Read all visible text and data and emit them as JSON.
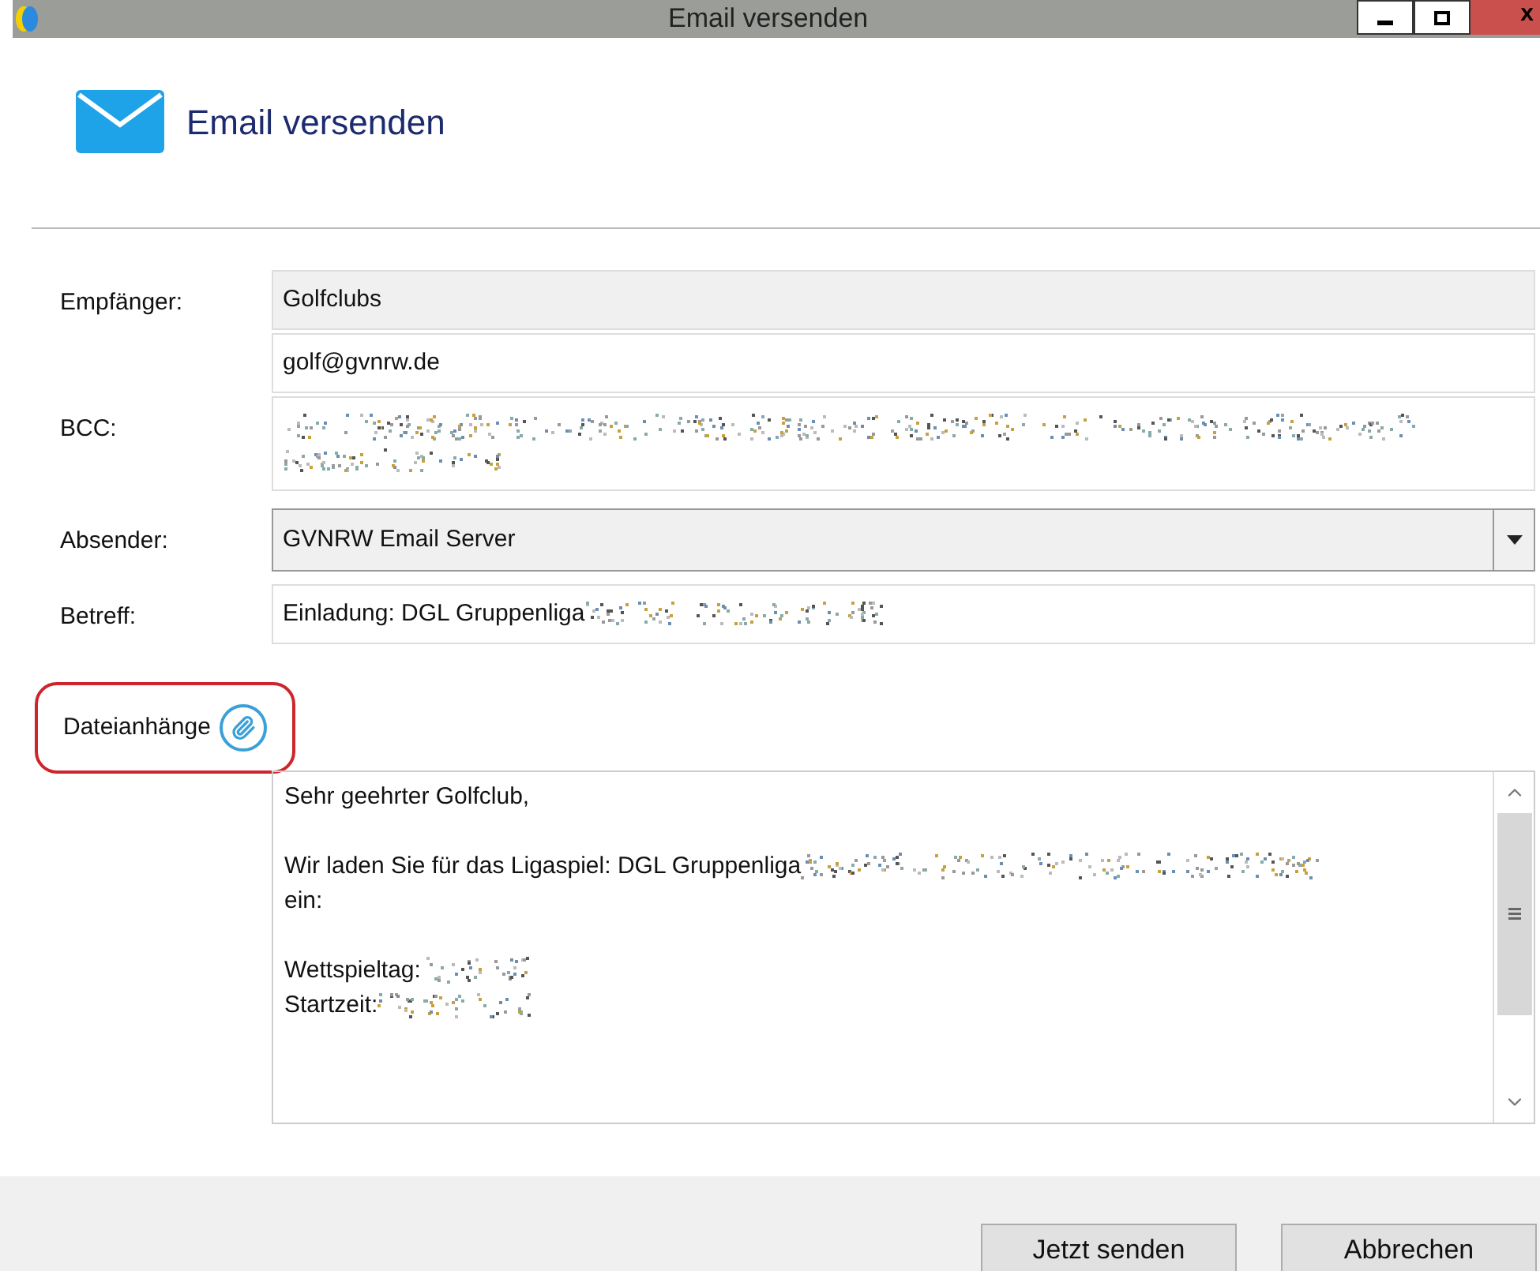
{
  "window": {
    "title": "Email versenden",
    "close_label": "x"
  },
  "header": {
    "title": "Email versenden"
  },
  "fields": [
    {
      "kind": "text",
      "label": "Empfänger:",
      "value": "Golfclubs",
      "readonly": true
    },
    {
      "kind": "text",
      "value": "golf@gvnrw.de",
      "readonly": false
    },
    {
      "kind": "redacted",
      "label": "BCC:",
      "readonly": false
    },
    {
      "kind": "select",
      "label": "Absender:",
      "value": "GVNRW Email Server",
      "readonly": true
    },
    {
      "kind": "text",
      "label": "Betreff:",
      "value": "Einladung: DGL Gruppenliga",
      "redacted": true,
      "readonly": false
    }
  ],
  "attachments": {
    "label": "Dateianhänge",
    "highlighted": true
  },
  "body": {
    "lines": [
      {
        "kind": "text",
        "text": "Sehr geehrter Golfclub,",
        "redacted": false
      },
      {
        "kind": "blank"
      },
      {
        "kind": "text",
        "text": "Wir laden Sie für das Ligaspiel: DGL Gruppenliga",
        "redacted": true
      },
      {
        "kind": "text",
        "text": "ein:",
        "redacted": false
      },
      {
        "kind": "blank"
      },
      {
        "kind": "text",
        "text": "Wettspieltag:",
        "redacted": true
      },
      {
        "kind": "text",
        "text": "Startzeit:",
        "redacted": true
      }
    ]
  },
  "buttons": [
    {
      "label": "Jetzt senden"
    },
    {
      "label": "Abbrechen"
    }
  ]
}
